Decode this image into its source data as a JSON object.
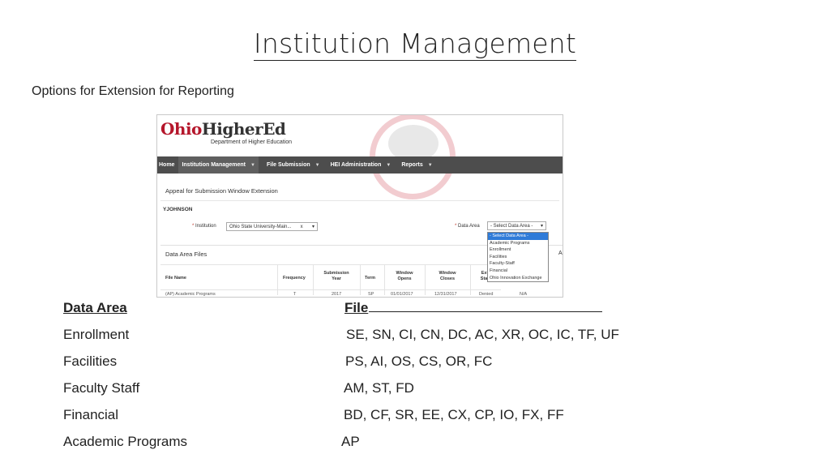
{
  "slide": {
    "title": "Institution Management",
    "subtitle": "Options for Extension for Reporting"
  },
  "screenshot": {
    "brand": {
      "ohio": "Ohio",
      "higher": "HigherEd",
      "sub": "Department of Higher Education"
    },
    "nav": [
      {
        "label": "Home"
      },
      {
        "label": "Institution Management"
      },
      {
        "label": "File Submission"
      },
      {
        "label": "HEI Administration"
      },
      {
        "label": "Reports"
      }
    ],
    "panel_title": "Appeal for Submission Window Extension",
    "user": "YJOHNSON",
    "institution_label": "Institution",
    "institution_value": "Ohio State University-Main...",
    "institution_clear": "x",
    "data_area_label": "Data Area",
    "data_area_value": "- Select Data Area -",
    "dropdown_options": [
      "- Select Data Area -",
      "Academic Programs",
      "Enrollment",
      "Facilities",
      "Faculty-Staff",
      "Financial",
      "Ohio Innovation Exchange"
    ],
    "files_title": "Data Area Files",
    "side_letter": "A",
    "table_headers": [
      "File Name",
      "Frequency",
      "Submission\nYear",
      "Term",
      "Window\nOpens",
      "Window\nCloses",
      "Ext\nStat"
    ],
    "table_row": [
      "(AP) Academic Programs",
      "T",
      "2017",
      "SP",
      "01/01/2017",
      "12/31/2017",
      "Denied",
      "N/A"
    ]
  },
  "table": {
    "header_area": "Data Area",
    "header_file": "File",
    "rows": [
      {
        "area": "Enrollment",
        "files": "SE, SN, CI, CN, DC, AC, XR, OC, IC, TF, UF"
      },
      {
        "area": "Facilities",
        "files": "PS, AI, OS, CS, OR, FC"
      },
      {
        "area": "Faculty Staff",
        "files": "AM, ST, FD"
      },
      {
        "area": "Financial",
        "files": "BD, CF, SR, EE, CX, CP, IO, FX, FF"
      },
      {
        "area": "Academic Programs",
        "files": "AP"
      }
    ]
  },
  "colors": {
    "nav_bg": "#4d4d4d",
    "brand_red": "#b5162b",
    "dropdown_highlight": "#2f7bd8"
  }
}
